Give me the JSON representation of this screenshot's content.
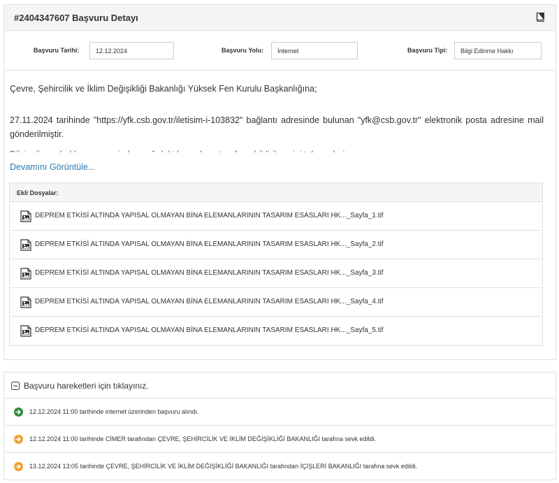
{
  "header": {
    "title": "#2404347607 Başvuru Detayı",
    "icon": "book-icon"
  },
  "meta": {
    "date_label": "Başvuru Tarihi:",
    "date_value": "12.12.2024",
    "channel_label": "Başvuru Yolu:",
    "channel_value": "İnternet",
    "type_label": "Başvuru Tipi:",
    "type_value": "Bilgi Edinme Hakkı"
  },
  "content": {
    "p1": "Çevre, Şehircilik ve İklim Değişikliği Bakanlığı Yüksek Fen Kurulu Başkanlığına;",
    "p2": "27.11.2024 tarihinde \"https://yfk.csb.gov.tr/iletisim-i-103832\" bağlantı adresinde bulunan \"yfk@csb.gov.tr\" elektronik posta adresine mail gönderilmiştir.",
    "p3": "Bilgi edinme hakkı çerçevesinde aşağıdaki hususların tarafıma bildirilmesini talep ederim.",
    "more_link": "Devamını Görüntüle..."
  },
  "attachments": {
    "header": "Ekli Dosyalar:",
    "icon": "image-file-icon",
    "files": [
      "DEPREM ETKİSİ ALTINDA YAPISAL OLMAYAN BİNA ELEMANLARININ TASARIM ESASLARI HK..._Sayfa_1.tif",
      "DEPREM ETKİSİ ALTINDA YAPISAL OLMAYAN BİNA ELEMANLARININ TASARIM ESASLARI HK..._Sayfa_2.tif",
      "DEPREM ETKİSİ ALTINDA YAPISAL OLMAYAN BİNA ELEMANLARININ TASARIM ESASLARI HK..._Sayfa_3.tif",
      "DEPREM ETKİSİ ALTINDA YAPISAL OLMAYAN BİNA ELEMANLARININ TASARIM ESASLARI HK..._Sayfa_4.tif",
      "DEPREM ETKİSİ ALTINDA YAPISAL OLMAYAN BİNA ELEMANLARININ TASARIM ESASLARI HK..._Sayfa_5.tif"
    ]
  },
  "movements": {
    "toggle_label": "Başvuru hareketleri için tıklayınız.",
    "toggle_icon": "minus-square-icon",
    "items": [
      {
        "text": "12.12.2024 11:00 tarihinde internet üzerinden başvuru alındı.",
        "color": "#2e8b3a",
        "icon": "arrow-circle-right-icon"
      },
      {
        "text": "12.12.2024 11:00 tarihinde CİMER tarafından ÇEVRE, ŞEHİRCİLİK VE İKLİM DEĞİŞİKLİĞİ BAKANLIĞI tarafına sevk edildi.",
        "color": "#f0a030",
        "icon": "arrow-circle-right-icon"
      },
      {
        "text": "13.12.2024 13:05 tarihinde ÇEVRE, ŞEHİRCİLİK VE İKLİM DEĞİŞİKLİĞİ BAKANLIĞI tarafından İÇİŞLERİ BAKANLIĞI tarafına sevk edildi.",
        "color": "#f0a030",
        "icon": "arrow-circle-right-icon"
      }
    ]
  },
  "colors": {
    "link": "#2a7ab0",
    "border": "#e1e1e1",
    "header_bg": "#f5f5f5"
  }
}
